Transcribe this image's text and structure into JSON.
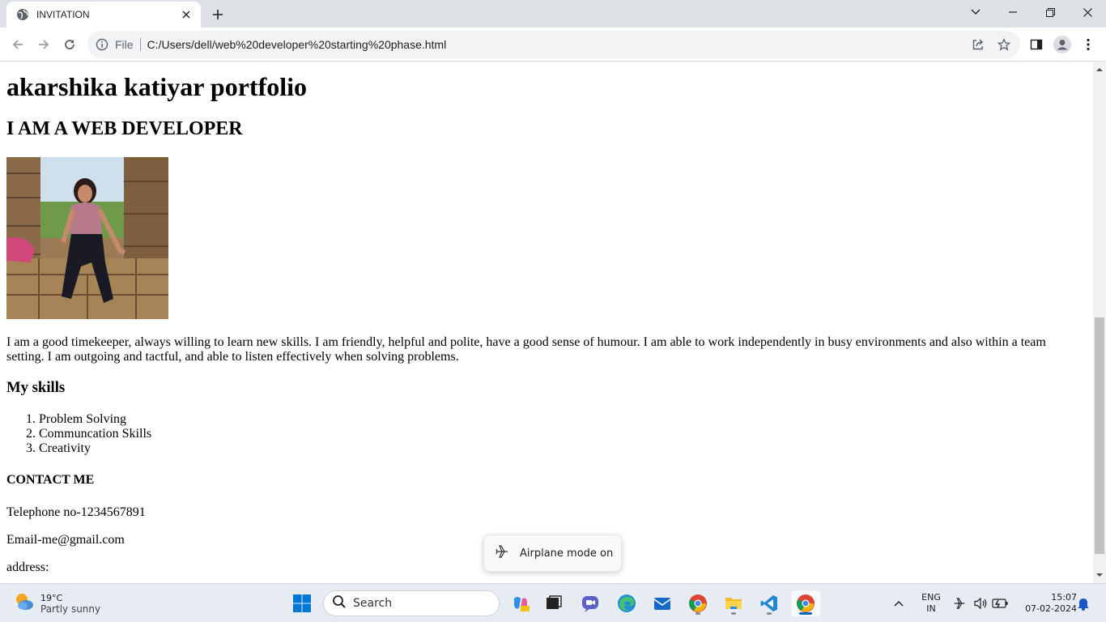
{
  "browser": {
    "tab_title": "INVITATION",
    "omnibox_scheme": "File",
    "url": "C:/Users/dell/web%20developer%20starting%20phase.html"
  },
  "page": {
    "heading": "akarshika katiyar portfolio",
    "subheading": "I AM A WEB DEVELOPER",
    "about": "I am a good timekeeper, always willing to learn new skills. I am friendly, helpful and polite, have a good sense of humour. I am able to work independently in busy environments and also within a team setting. I am outgoing and tactful, and able to listen effectively when solving problems.",
    "skills_heading": "My skills",
    "skills": [
      "Problem Solving",
      "Communcation Skills",
      "Creativity"
    ],
    "contact_heading": "CONTACT ME",
    "telephone": "Telephone no-1234567891",
    "email": "Email-me@gmail.com",
    "address": "address:"
  },
  "toast": {
    "label": "Airplane mode on"
  },
  "taskbar": {
    "weather_temp": "19°C",
    "weather_condition": "Partly sunny",
    "search_label": "Search",
    "language_top": "ENG",
    "language_bottom": "IN",
    "time": "15:07",
    "date": "07-02-2024"
  },
  "colors": {
    "tab_strip": "#dee1e6",
    "omnibox": "#f1f3f4",
    "taskbar": "#e7ecf3",
    "accent": "#0067c0"
  }
}
